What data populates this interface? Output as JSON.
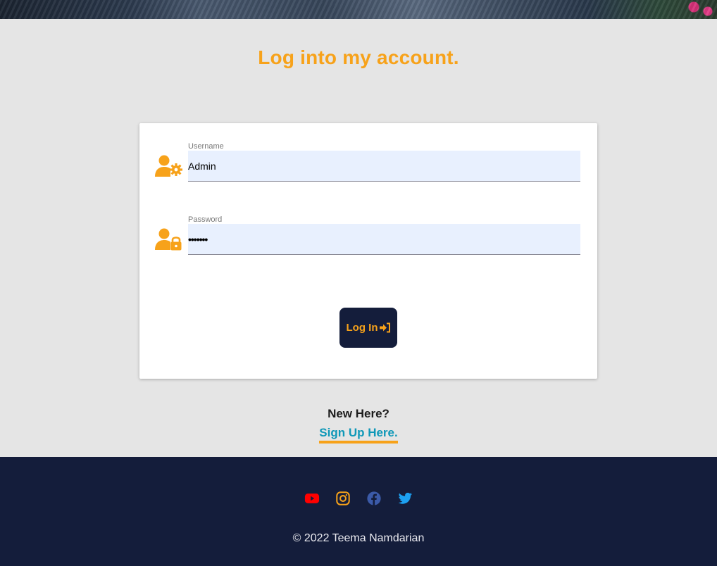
{
  "page": {
    "title": "Log into my account."
  },
  "form": {
    "username": {
      "label": "Username",
      "value": "Admin",
      "icon": "user-gear-icon"
    },
    "password": {
      "label": "Password",
      "value": "•••••••",
      "icon": "user-lock-icon"
    },
    "submit_label": "Log In",
    "submit_icon": "sign-in-icon"
  },
  "signup": {
    "prompt": "New Here?",
    "link_label": "Sign Up Here."
  },
  "footer": {
    "social": [
      {
        "name": "youtube-icon",
        "color": "#ff0000"
      },
      {
        "name": "instagram-icon",
        "color": "#f7a21a"
      },
      {
        "name": "facebook-icon",
        "color": "#3b5aa8"
      },
      {
        "name": "twitter-icon",
        "color": "#1da1f2"
      }
    ],
    "copyright": "© 2022 Teema Namdarian"
  },
  "colors": {
    "accent": "#f7a21a",
    "navy": "#141d3b",
    "link": "#0f98b8",
    "background": "#e5e5e5"
  }
}
